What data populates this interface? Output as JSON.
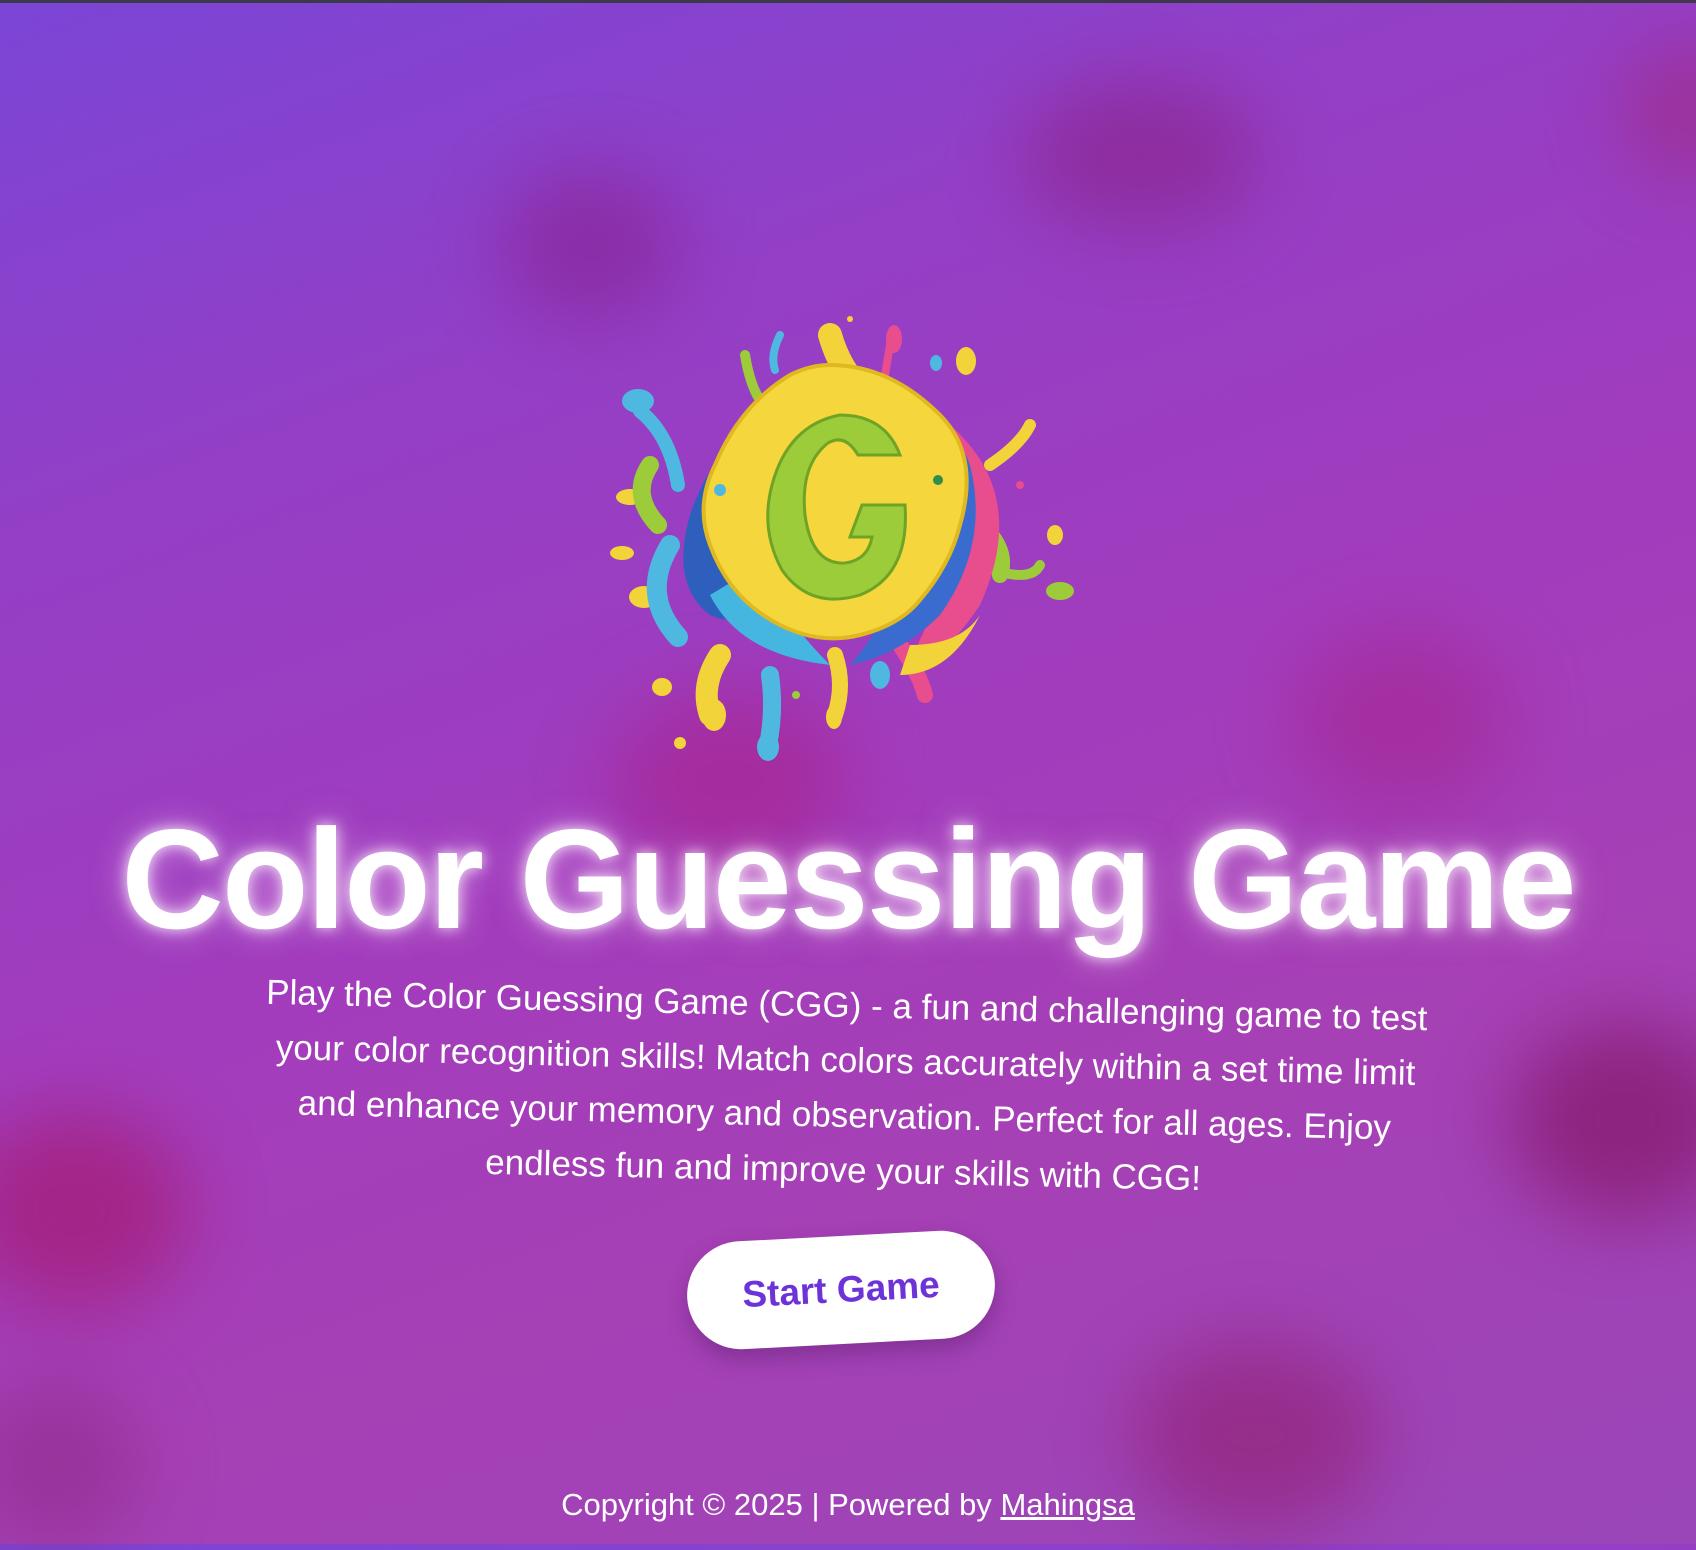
{
  "page": {
    "title": "Color Guessing Game",
    "description": "Play the Color Guessing Game (CGG) - a fun and challenging game to test your color recognition skills! Match colors accurately within a set time limit and enhance your memory and observation. Perfect for all ages. Enjoy endless fun and improve your skills with CGG!",
    "start_button_label": "Start Game",
    "logo_icon": "colorful-splash-g-logo"
  },
  "footer": {
    "copyright_text": "Copyright © 2025 | Powered by ",
    "link_text": "Mahingsa"
  },
  "colors": {
    "background_start": "#7b45d6",
    "background_end": "#a640b5",
    "button_text": "#6e33d8",
    "button_background": "#ffffff",
    "text": "#ffffff"
  }
}
